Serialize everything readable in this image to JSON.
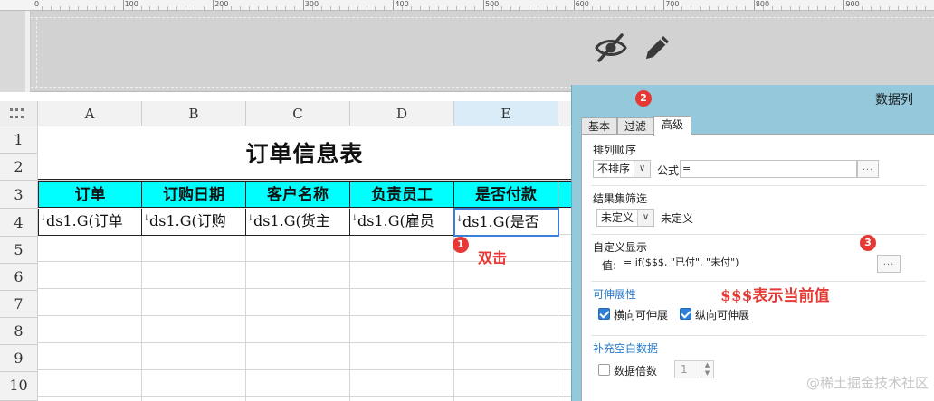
{
  "ruler": {
    "marks": [
      "0",
      "100",
      "200",
      "300",
      "400",
      "500",
      "600",
      "700",
      "800",
      "900"
    ]
  },
  "toolbar": {
    "hide_icon": "eye-off-icon",
    "edit_icon": "pencil-icon"
  },
  "sheet": {
    "columns": [
      "A",
      "B",
      "C",
      "D",
      "E"
    ],
    "rows": [
      "1",
      "2",
      "3",
      "4",
      "5",
      "6",
      "7",
      "8",
      "9",
      "10"
    ],
    "title": "订单信息表",
    "headers": [
      "订单",
      "订购日期",
      "客户名称",
      "负责员工",
      "是否付款"
    ],
    "data_cells": [
      "ds1.G(订单",
      "ds1.G(订购",
      "ds1.G(货主",
      "ds1.G(雇员",
      "ds1.G(是否"
    ],
    "selected_column": "E",
    "accent_color": "#00ffff"
  },
  "annotations": {
    "badge1": "1",
    "badge2": "2",
    "badge3": "3",
    "double_click_note": "双击",
    "value_note": "$$$表示当前值",
    "note_color": "#e53935"
  },
  "dialog": {
    "title": "数据列",
    "tabs": [
      "基本",
      "过滤",
      "高级"
    ],
    "active_tab": "高级",
    "sort": {
      "label": "排列顺序",
      "value": "不排序",
      "formula_label": "公式:",
      "formula_value": "=",
      "more": "..."
    },
    "filter": {
      "label": "结果集筛选",
      "value": "未定义",
      "value_text": "未定义"
    },
    "custom_display": {
      "label": "自定义显示",
      "value_label": "值:",
      "value": "= if($$$, \"已付\", \"未付\")",
      "more": "..."
    },
    "expand": {
      "label": "可伸展性",
      "horizontal": "横向可伸展",
      "vertical": "纵向可伸展",
      "horizontal_checked": true,
      "vertical_checked": true
    },
    "fill_blank": {
      "label": "补充空白数据",
      "multiple_label": "数据倍数",
      "multiple_checked": false,
      "multiple_value": "1"
    }
  },
  "watermark": "@稀土掘金技术社区"
}
